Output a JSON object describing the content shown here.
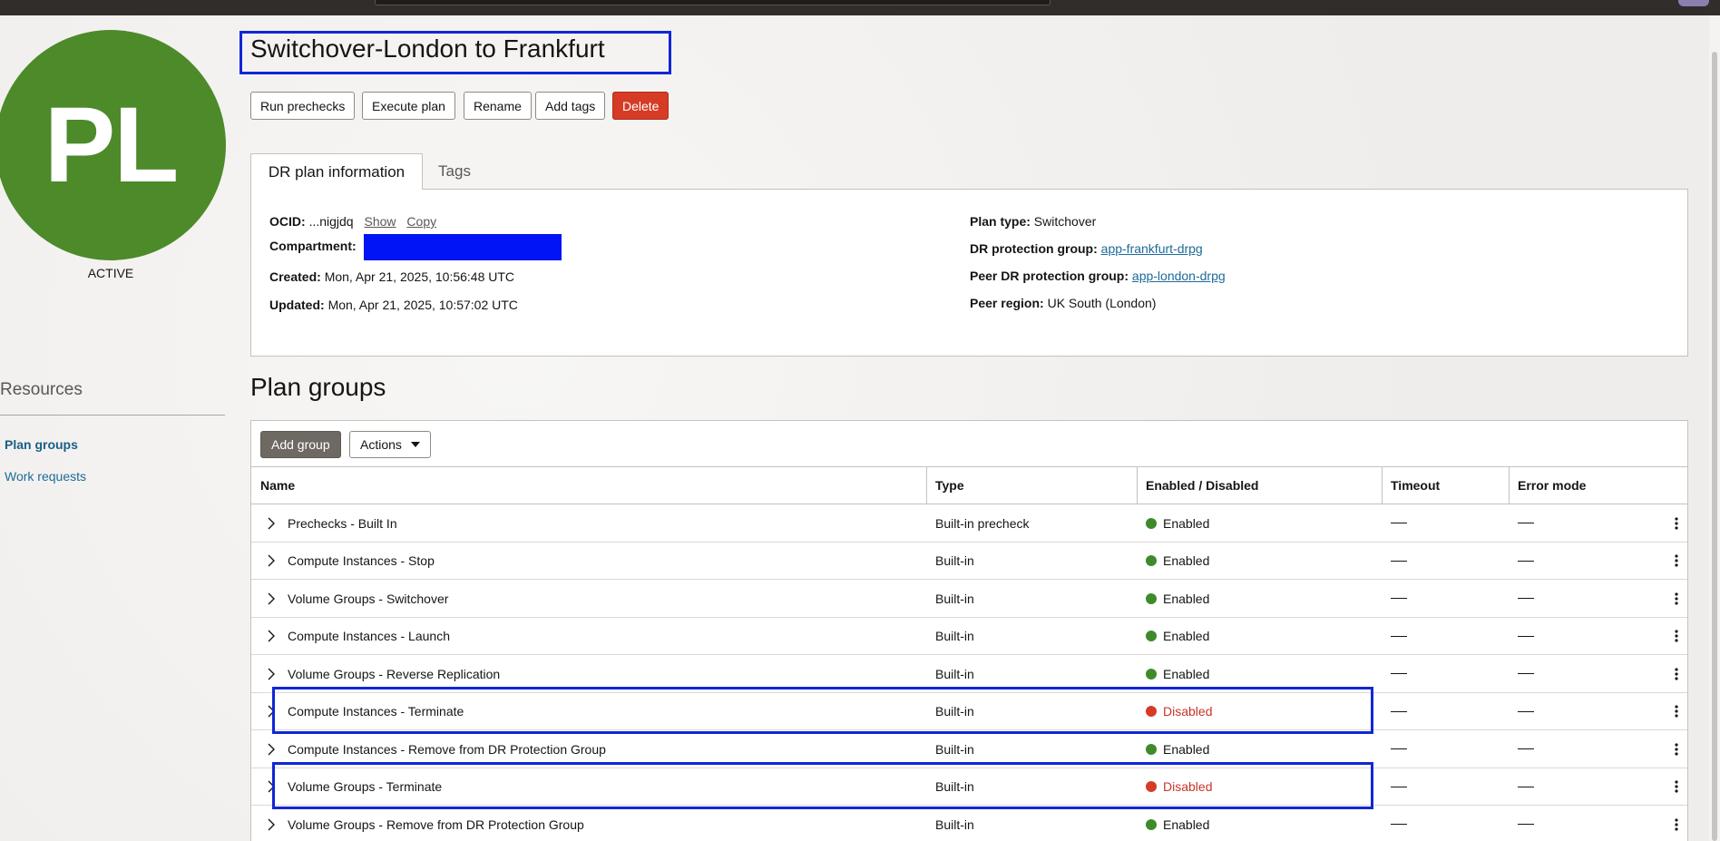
{
  "avatar": {
    "initials": "PL",
    "state": "ACTIVE",
    "color": "#4d8a2a"
  },
  "plan": {
    "title": "Switchover-London to Frankfurt"
  },
  "actions": {
    "run_prechecks": "Run prechecks",
    "execute_plan": "Execute plan",
    "rename": "Rename",
    "add_tags": "Add tags",
    "delete": "Delete"
  },
  "tabs": {
    "info": "DR plan information",
    "tags": "Tags"
  },
  "info": {
    "ocid_label": "OCID:",
    "ocid_value": "...nigjdq",
    "show": "Show",
    "copy": "Copy",
    "compartment_label": "Compartment:",
    "created_label": "Created:",
    "created_value": "Mon, Apr 21, 2025, 10:56:48 UTC",
    "updated_label": "Updated:",
    "updated_value": "Mon, Apr 21, 2025, 10:57:02 UTC",
    "plan_type_label": "Plan type:",
    "plan_type_value": "Switchover",
    "drpg_label": "DR protection group:",
    "drpg_value": "app-frankfurt-drpg",
    "peer_drpg_label": "Peer DR protection group:",
    "peer_drpg_value": "app-london-drpg",
    "peer_region_label": "Peer region:",
    "peer_region_value": "UK South (London)"
  },
  "resources": {
    "title": "Resources",
    "plan_groups": "Plan groups",
    "work_requests": "Work requests"
  },
  "plan_groups": {
    "title": "Plan groups",
    "add_group": "Add group",
    "actions": "Actions",
    "columns": {
      "name": "Name",
      "type": "Type",
      "enabled": "Enabled / Disabled",
      "timeout": "Timeout",
      "error_mode": "Error mode"
    },
    "rows": [
      {
        "name": "Prechecks - Built In",
        "type": "Built-in precheck",
        "status": "Enabled"
      },
      {
        "name": "Compute Instances - Stop",
        "type": "Built-in",
        "status": "Enabled"
      },
      {
        "name": "Volume Groups - Switchover",
        "type": "Built-in",
        "status": "Enabled"
      },
      {
        "name": "Compute Instances - Launch",
        "type": "Built-in",
        "status": "Enabled"
      },
      {
        "name": "Volume Groups - Reverse Replication",
        "type": "Built-in",
        "status": "Enabled"
      },
      {
        "name": "Compute Instances - Terminate",
        "type": "Built-in",
        "status": "Disabled"
      },
      {
        "name": "Compute Instances - Remove from DR Protection Group",
        "type": "Built-in",
        "status": "Enabled"
      },
      {
        "name": "Volume Groups - Terminate",
        "type": "Built-in",
        "status": "Disabled"
      },
      {
        "name": "Volume Groups - Remove from DR Protection Group",
        "type": "Built-in",
        "status": "Enabled"
      }
    ]
  },
  "colors": {
    "enabled": "#3f8a2b",
    "disabled": "#d63b25",
    "disabled_text": "#c7342a",
    "highlight": "#1126d6",
    "link": "#1c6b99"
  }
}
